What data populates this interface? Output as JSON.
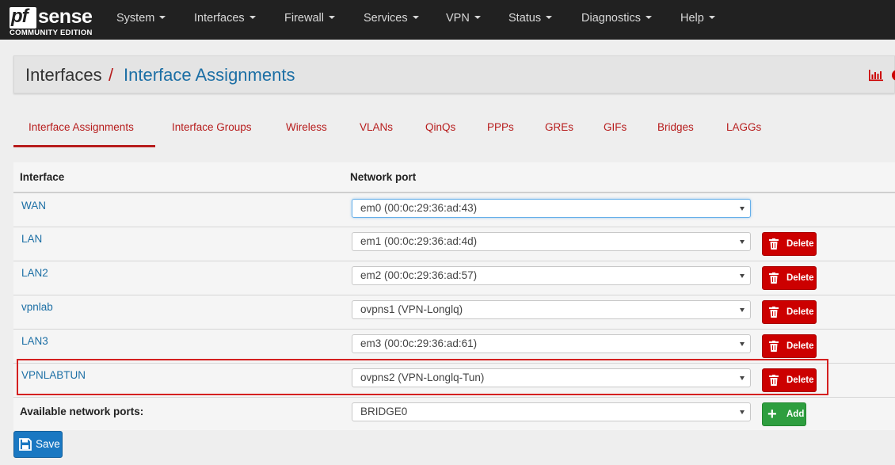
{
  "brand": {
    "left": "pf",
    "right": "sense",
    "edition": "COMMUNITY EDITION"
  },
  "nav": [
    "System",
    "Interfaces",
    "Firewall",
    "Services",
    "VPN",
    "Status",
    "Diagnostics",
    "Help"
  ],
  "breadcrumb": {
    "root": "Interfaces",
    "separator": "/",
    "current": "Interface Assignments"
  },
  "tabs": [
    "Interface Assignments",
    "Interface Groups",
    "Wireless",
    "VLANs",
    "QinQs",
    "PPPs",
    "GREs",
    "GIFs",
    "Bridges",
    "LAGGs"
  ],
  "active_tab": "Interface Assignments",
  "table": {
    "headers": [
      "Interface",
      "Network port"
    ],
    "rows": [
      {
        "interface": "WAN",
        "port": "em0 (00:0c:29:36:ad:43)"
      },
      {
        "interface": "LAN",
        "port": "em1 (00:0c:29:36:ad:4d)",
        "action": "Delete"
      },
      {
        "interface": "LAN2",
        "port": "em2 (00:0c:29:36:ad:57)",
        "action": "Delete"
      },
      {
        "interface": "vpnlab",
        "port": "ovpns1 (VPN-Longlq)",
        "action": "Delete"
      },
      {
        "interface": "LAN3",
        "port": "em3 (00:0c:29:36:ad:61)",
        "action": "Delete"
      },
      {
        "interface": "VPNLABTUN",
        "port": "ovpns2 (VPN-Longlq-Tun)",
        "action": "Delete"
      }
    ],
    "available": {
      "label": "Available network ports:",
      "port": "BRIDGE0",
      "action": "Add"
    }
  },
  "save_label": "Save",
  "icons": {
    "chart": "bar-chart-icon",
    "help": "help-icon",
    "delete": "trash-icon",
    "add": "plus-icon",
    "save": "floppy-disk-icon"
  },
  "colors": {
    "navbar": "#212121",
    "accent_red": "#b71c1c",
    "link_blue": "#1c6fa5",
    "delete_red": "#cc0000",
    "add_green": "#2e9e3f",
    "save_blue": "#1a78c2",
    "highlight_box": "#d42020"
  }
}
